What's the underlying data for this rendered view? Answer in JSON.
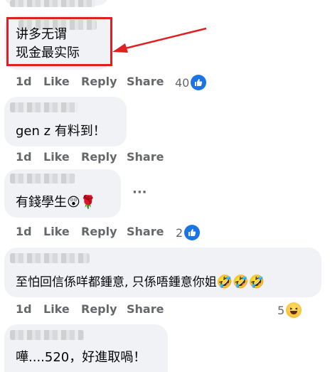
{
  "comments": [
    {
      "text_lines": [
        "讲多无谓",
        "现金最实际"
      ],
      "meta": {
        "time": "1d",
        "like": "Like",
        "reply": "Reply",
        "share": "Share"
      },
      "reactions": {
        "count": "40",
        "type": "like-icon"
      }
    },
    {
      "text_lines": [
        "gen z 有料到！"
      ],
      "meta": {
        "time": "1d",
        "like": "Like",
        "reply": "Reply",
        "share": "Share"
      }
    },
    {
      "text_lines": [
        "有錢學生"
      ],
      "emojis": [
        "😲",
        "🌹"
      ],
      "more": "···",
      "meta": {
        "time": "1d",
        "like": "Like",
        "reply": "Reply",
        "share": "Share"
      },
      "reactions": {
        "count": "2",
        "type": "like-icon"
      }
    },
    {
      "text_lines": [
        "至怕回信係咩都鍾意, 只係唔鍾意你姐"
      ],
      "emojis": [
        "🤣",
        "🤣",
        "🤣"
      ],
      "meta": {
        "time": "1d",
        "like": "Like",
        "reply": "Reply",
        "share": "Share"
      },
      "reactions": {
        "count": "5",
        "type": "haha-icon"
      }
    },
    {
      "text_lines": [
        "嘩....520，好進取喎！"
      ]
    }
  ],
  "colors": {
    "highlight_border": "#e02020",
    "bubble": "#f0f2f5",
    "meta": "#65676b",
    "like_blue": "#1b74e4"
  }
}
